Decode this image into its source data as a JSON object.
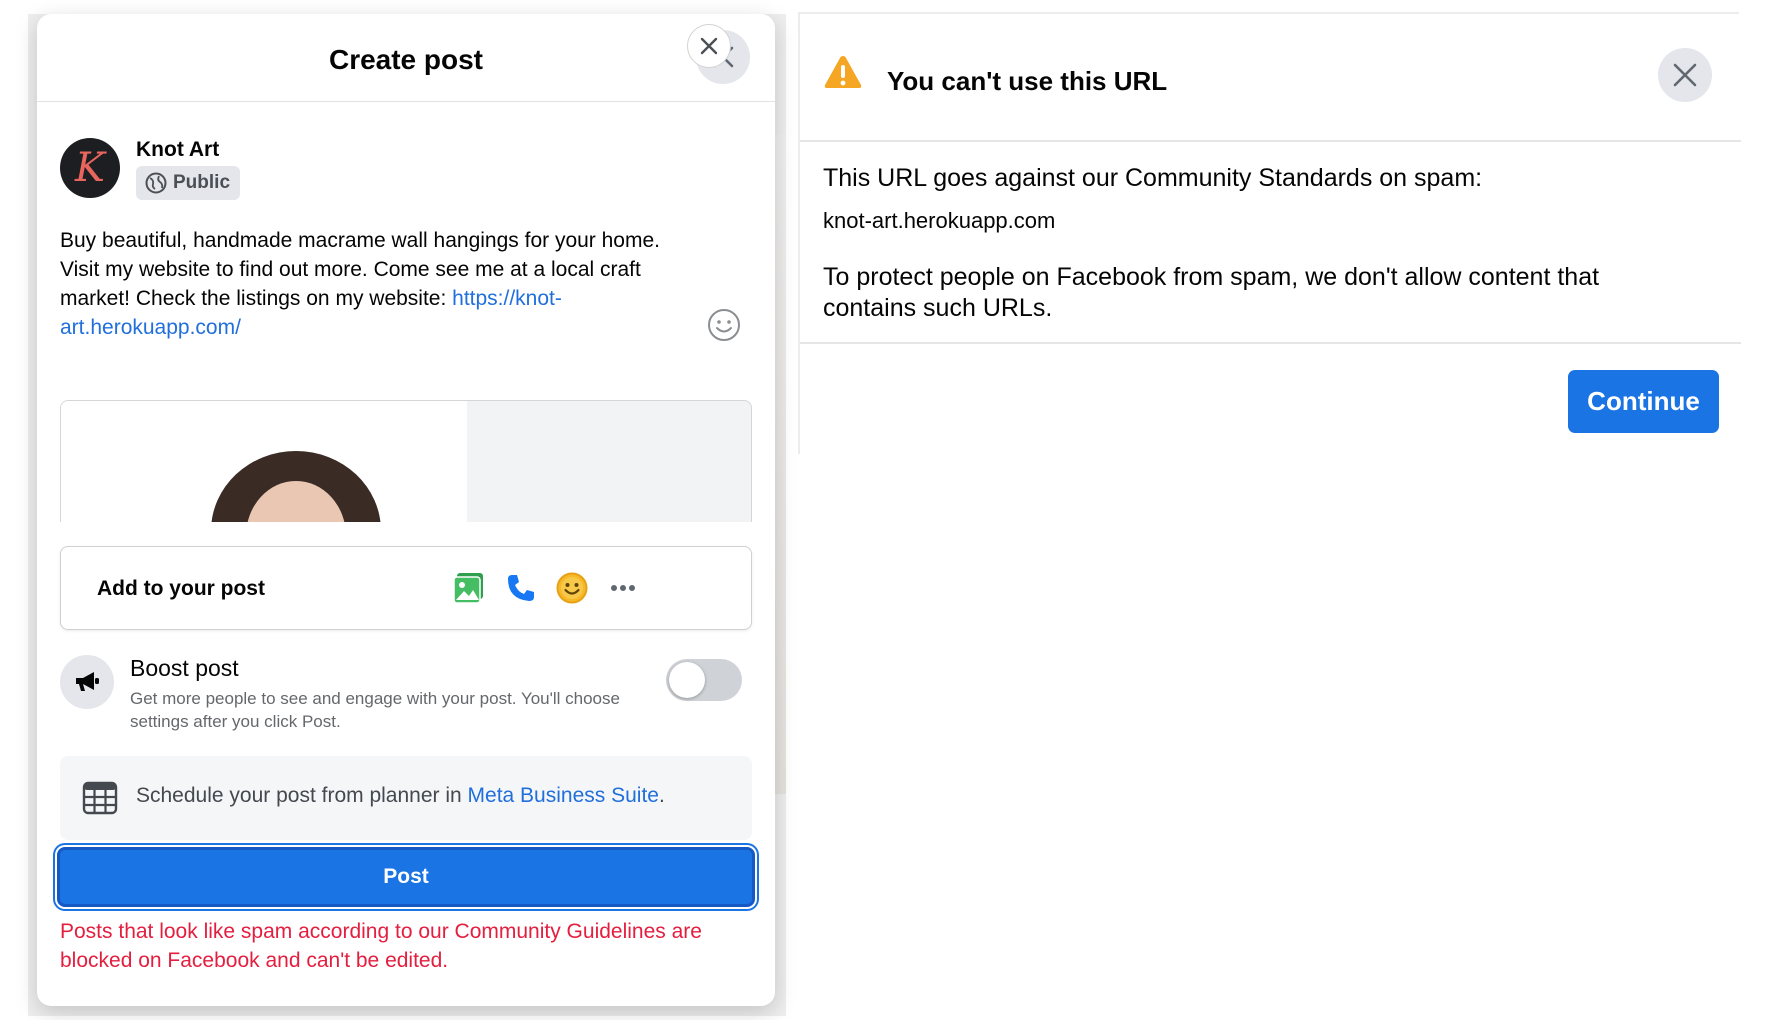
{
  "create_post": {
    "title": "Create post",
    "author": {
      "name": "Knot Art",
      "avatar_letter": "K",
      "audience": "Public"
    },
    "post_text": "Buy beautiful, handmade macrame wall hangings for your home. Visit my website to find out more. Come see me at a local craft market! Check the listings on my website: ",
    "post_link": "https://knot-art.herokuapp.com/",
    "add_to_post": {
      "label": "Add to your post",
      "icons": [
        "photo-video-icon",
        "phone-icon",
        "feeling-icon",
        "more-icon"
      ]
    },
    "boost": {
      "title": "Boost post",
      "description": "Get more people to see and engage with your post. You'll choose settings after you click Post.",
      "enabled": false
    },
    "schedule": {
      "text": "Schedule your post from planner in ",
      "link": "Meta Business Suite",
      "suffix": "."
    },
    "post_button": "Post",
    "error": "Posts that look like spam according to our Community Guidelines are blocked on Facebook and can't be edited."
  },
  "url_dialog": {
    "title": "You can't use this URL",
    "line1": "This URL goes against our Community Standards on spam:",
    "url": "knot-art.herokuapp.com",
    "explanation": "To protect people on Facebook from spam, we don't allow content that contains such URLs.",
    "continue_button": "Continue"
  },
  "colors": {
    "accent": "#1b74e4",
    "link": "#216fdb",
    "error": "#e41e3f",
    "warning": "#f5a623"
  }
}
